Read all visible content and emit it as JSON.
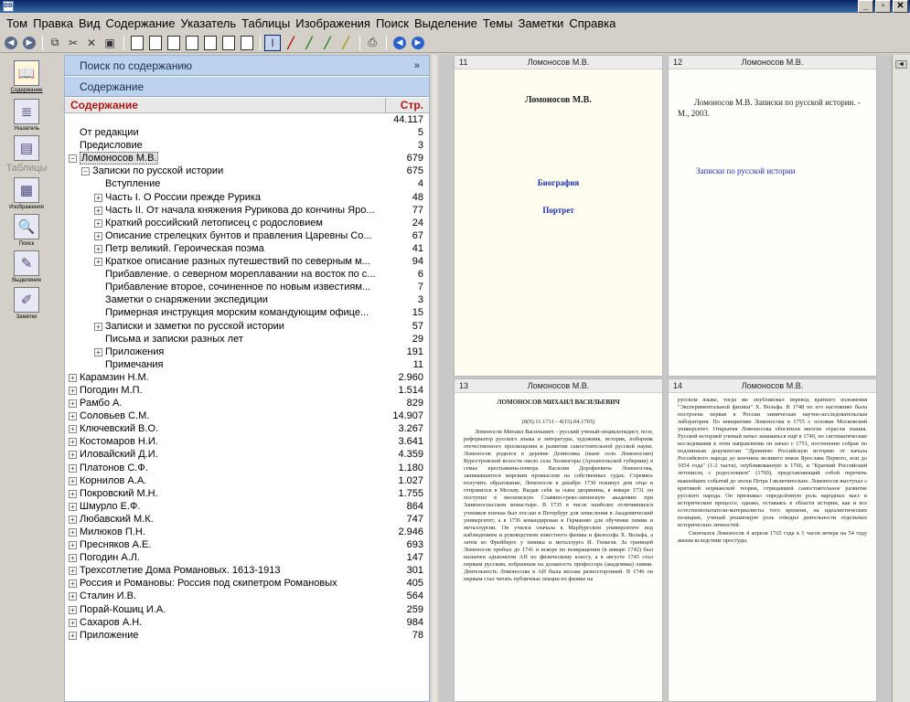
{
  "window": {
    "icon_text": "BB",
    "minimize": "_",
    "maximize": "▫",
    "close": "✕"
  },
  "menu": [
    "Том",
    "Правка",
    "Вид",
    "Содержание",
    "Указатель",
    "Таблицы",
    "Изображения",
    "Поиск",
    "Выделение",
    "Темы",
    "Заметки",
    "Справка"
  ],
  "leftbar": {
    "items": [
      {
        "label": "Содержание",
        "icon": "book-icon"
      },
      {
        "label": "Указатель",
        "icon": "index-icon"
      },
      {
        "label": "Таблицы",
        "icon": "table-icon"
      },
      {
        "label": "Изображения",
        "icon": "images-icon"
      },
      {
        "label": "Поиск",
        "icon": "search-icon"
      },
      {
        "label": "Выделения",
        "icon": "highlight-icon"
      },
      {
        "label": "Заметки",
        "icon": "notes-icon"
      }
    ]
  },
  "panel": {
    "search_header": "Поиск по содержанию",
    "search_chevron": "»",
    "contents_header": "Содержание",
    "col_title": "Содержание",
    "col_page": "Стр.",
    "rows": [
      {
        "label": "",
        "page": "44.117",
        "level": 0,
        "exp": ""
      },
      {
        "label": "От редакции",
        "page": "5",
        "level": 0,
        "exp": ""
      },
      {
        "label": "Предисловие",
        "page": "3",
        "level": 0,
        "exp": ""
      },
      {
        "label": "Ломоносов М.В.",
        "page": "679",
        "level": 0,
        "exp": "-",
        "selected": true
      },
      {
        "label": "Записки по русской истории",
        "page": "675",
        "level": 1,
        "exp": "-"
      },
      {
        "label": "Вступление",
        "page": "4",
        "level": 2,
        "exp": ""
      },
      {
        "label": "Часть I. О России прежде Рурика",
        "page": "48",
        "level": 2,
        "exp": "+"
      },
      {
        "label": "Часть II. От начала княжения Рурикова до кончины Яро...",
        "page": "77",
        "level": 2,
        "exp": "+"
      },
      {
        "label": "Краткий российский летописец с родословием",
        "page": "24",
        "level": 2,
        "exp": "+"
      },
      {
        "label": "Описание стрелецких бунтов и правления Царевны Со...",
        "page": "67",
        "level": 2,
        "exp": "+"
      },
      {
        "label": "Петр великий. Героическая поэма",
        "page": "41",
        "level": 2,
        "exp": "+"
      },
      {
        "label": "Краткое описание разных путешествий по северным м...",
        "page": "94",
        "level": 2,
        "exp": "+"
      },
      {
        "label": "Прибавление. о северном мореплавании на восток по с...",
        "page": "6",
        "level": 2,
        "exp": ""
      },
      {
        "label": "Прибавление второе, сочиненное по новым известиям...",
        "page": "7",
        "level": 2,
        "exp": ""
      },
      {
        "label": "Заметки о снаряжении экспедиции",
        "page": "3",
        "level": 2,
        "exp": ""
      },
      {
        "label": "Примерная инструкция морским командующим офице...",
        "page": "15",
        "level": 2,
        "exp": ""
      },
      {
        "label": "Записки и заметки по русской истории",
        "page": "57",
        "level": 2,
        "exp": "+"
      },
      {
        "label": "Письма и записки разных лет",
        "page": "29",
        "level": 2,
        "exp": ""
      },
      {
        "label": "Приложения",
        "page": "191",
        "level": 2,
        "exp": "+"
      },
      {
        "label": "Примечания",
        "page": "11",
        "level": 2,
        "exp": ""
      },
      {
        "label": "Карамзин Н.М.",
        "page": "2.960",
        "level": 0,
        "exp": "+"
      },
      {
        "label": "Погодин М.П.",
        "page": "1.514",
        "level": 0,
        "exp": "+"
      },
      {
        "label": "Рамбо А.",
        "page": "829",
        "level": 0,
        "exp": "+"
      },
      {
        "label": "Соловьев С.М.",
        "page": "14.907",
        "level": 0,
        "exp": "+"
      },
      {
        "label": "Ключевский В.О.",
        "page": "3.267",
        "level": 0,
        "exp": "+"
      },
      {
        "label": "Костомаров Н.И.",
        "page": "3.641",
        "level": 0,
        "exp": "+"
      },
      {
        "label": "Иловайский Д.И.",
        "page": "4.359",
        "level": 0,
        "exp": "+"
      },
      {
        "label": "Платонов С.Ф.",
        "page": "1.180",
        "level": 0,
        "exp": "+"
      },
      {
        "label": "Корнилов А.А.",
        "page": "1.027",
        "level": 0,
        "exp": "+"
      },
      {
        "label": "Покровский М.Н.",
        "page": "1.755",
        "level": 0,
        "exp": "+"
      },
      {
        "label": "Шмурло Е.Ф.",
        "page": "864",
        "level": 0,
        "exp": "+"
      },
      {
        "label": "Любавский М.К.",
        "page": "747",
        "level": 0,
        "exp": "+"
      },
      {
        "label": "Милюков П.Н.",
        "page": "2.946",
        "level": 0,
        "exp": "+"
      },
      {
        "label": "Пресняков А.Е.",
        "page": "693",
        "level": 0,
        "exp": "+"
      },
      {
        "label": "Погодин А.Л.",
        "page": "147",
        "level": 0,
        "exp": "+"
      },
      {
        "label": "Трехсотлетие Дома Романовых. 1613-1913",
        "page": "301",
        "level": 0,
        "exp": "+"
      },
      {
        "label": "Россия и Романовы: Россия под скипетром Романовых",
        "page": "405",
        "level": 0,
        "exp": "+"
      },
      {
        "label": "Сталин И.В.",
        "page": "564",
        "level": 0,
        "exp": "+"
      },
      {
        "label": "Порай-Кошиц И.А.",
        "page": "259",
        "level": 0,
        "exp": "+"
      },
      {
        "label": "Сахаров А.Н.",
        "page": "984",
        "level": 0,
        "exp": "+"
      },
      {
        "label": "Приложение",
        "page": "78",
        "level": 0,
        "exp": "+"
      }
    ]
  },
  "pages": {
    "p11": {
      "num": "11",
      "title": "Ломоносов М.В.",
      "heading": "Ломоносов М.В.",
      "link1": "Биография",
      "link2": "Портрет"
    },
    "p12": {
      "num": "12",
      "title": "Ломоносов М.В.",
      "text": "Ломоносов М.В. Записки по русской истории. - М., 2003.",
      "link": "Записки по русской истории"
    },
    "p13": {
      "num": "13",
      "title": "Ломоносов М.В.",
      "heading": "ЛОМОНОСОВ МИХАИЛ ВАСИЛЬЕВИЧ",
      "dates": "(8(9).11.1711 - 4(15).04.1765)",
      "body": "Ломоносов Михаил Васильевич - русский ученый-энциклопедист, поэт, реформатор русского языка и литературы, художник, историк, поборник отечественного просвещения и развития самостоятельной русской науки. Ломоносов родился в деревне Денисовка (ныне село Ломоносово) Куростровской волости около села Холмогоры (Архангельской губернии) в семье крестьянина-помора Василия Дорофеевича Ломоносова, занимавшегося морским промыслом на собственных судах. Стремясь получить образование, Ломоносов в декабре 1730 покинул дом отца и отправился в Москву. Выдав себя за сына дворянина, в январе 1731 он поступил в московскую Славяно-греко-латинскую академию при Заиконоспасском монастыре. В 1735 в числе наиболее отличившихся учеников юноша был послан в Петербург для зачисления в Академический университет, а в 1736 командирован в Германию для обучения химии и металлургии. Он учился сначала в Марбургском университете под наблюдением и руководством известного физика и философа Х. Вольфа, а затем во Фрейберге у химика и металлурга И. Генкеля. За границей Ломоносов пробыл до 1741 и вскоре по возвращении (в январе 1742) был назначен адъюнктом АН по физическому классу, а в августе 1745 стал первым русским, избранным на должность профессора (академика) химии. Деятельность Ломоносова в АН была весьма разносторонней. В 1746 он первым стал читать публичные лекции по физике на"
    },
    "p14": {
      "num": "14",
      "title": "Ломоносов М.В.",
      "body": "русском языке, тогда же опубликовал перевод краткого изложения \"Экспериментальной физики\" Х. Вольфа. В 1748 по его настоянию была построена первая в России химическая научно-исследовательская лаборатория. По инициативе Ломоносова в 1755 г. основан Московский университет. Открытия Ломоносова обогатили многие отрасли знания. Русской историей ученый начал заниматься ещё в 1749, но систематические исследования в этом направлении он начал с 1751, постепенно собрав по подлинным документам \"Древнюю Российскую историю от начала Российского народа до кончины великого князя Ярослава Первого, или до 1054 года\" (1-2 части), опубликованную в 1766, и \"Краткий Российский летописец с родословием\" (1760), представляющий собой перечень важнейших событий до эпохи Петра I включительно. Ломоносов выступал с критикой норманской теории, отрицавшей самостоятельное развитие русского народа. Он признавал определённую роль народных масс в историческом процессе, однако, оставаясь в области истории, как и все естествоиспытатели-материалисты того времени, на идеалистических позициях, ученый решающую роль отводил деятельности отдельных исторических личностей.",
      "body2": "Скончался Ломоносов 4 апреля 1765 года в 5 часов вечера на 54 году жизни вследствие простуды."
    }
  }
}
